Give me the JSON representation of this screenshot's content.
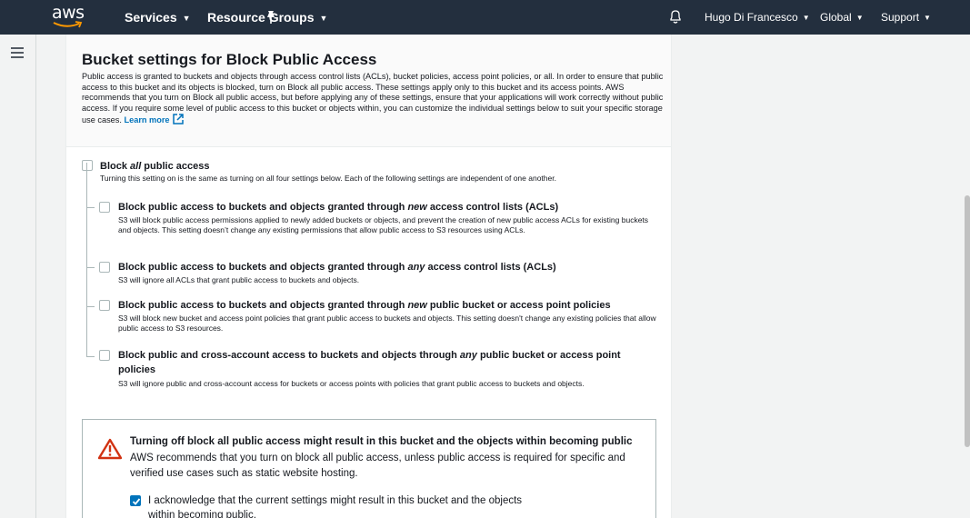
{
  "topnav": {
    "logo_text": "aws",
    "services": "Services",
    "resource_groups": "Resource Groups",
    "user": "Hugo Di Francesco",
    "region": "Global",
    "support": "Support",
    "caret": "▼"
  },
  "panel": {
    "title": "Bucket settings for Block Public Access",
    "description": "Public access is granted to buckets and objects through access control lists (ACLs), bucket policies, access point policies, or all. In order to ensure that public access to this bucket and its objects is blocked, turn on Block all public access. These settings apply only to this bucket and its access points. AWS recommends that you turn on Block all public access, but before applying any of these settings, ensure that your applications will work correctly without public access. If you require some level of public access to this bucket or objects within, you can customize the individual settings below to suit your specific storage use cases.",
    "learn_more": "Learn more"
  },
  "block_all": {
    "title_pre": "Block ",
    "title_em": "all",
    "title_post": " public access",
    "desc": "Turning this setting on is the same as turning on all four settings below. Each of the following settings are independent of one another.",
    "checked": false
  },
  "options": [
    {
      "title_pre": "Block public access to buckets and objects granted through ",
      "title_em": "new",
      "title_post": " access control lists (ACLs)",
      "desc": "S3 will block public access permissions applied to newly added buckets or objects, and prevent the creation of new public access ACLs for existing buckets and objects. This setting doesn’t change any existing permissions that allow public access to S3 resources using ACLs.",
      "checked": false
    },
    {
      "title_pre": "Block public access to buckets and objects granted through ",
      "title_em": "any",
      "title_post": " access control lists (ACLs)",
      "desc": "S3 will ignore all ACLs that grant public access to buckets and objects.",
      "checked": false
    },
    {
      "title_pre": "Block public access to buckets and objects granted through ",
      "title_em": "new",
      "title_post": " public bucket or access point policies",
      "desc": "S3 will block new bucket and access point policies that grant public access to buckets and objects. This setting doesn't change any existing policies that allow public access to S3 resources.",
      "checked": false
    },
    {
      "title_pre": "Block public and cross-account access to buckets and objects through ",
      "title_em": "any",
      "title_post": " public bucket or access point",
      "title_line2": "policies",
      "desc": "S3 will ignore public and cross-account access for buckets or access points with policies that grant public access to buckets and objects.",
      "checked": false
    }
  ],
  "warning": {
    "title": "Turning off block all public access might result in this bucket and the objects within becoming public",
    "desc": "AWS recommends that you turn on block all public access, unless public access is required for specific and verified use cases such as static website hosting.",
    "ack_label": "I acknowledge that the current settings might result in this bucket and the objects within becoming public.",
    "ack_checked": true
  },
  "colors": {
    "nav_bg": "#232f3e",
    "accent": "#0073bb",
    "warning_red": "#d13212",
    "logo_orange": "#ff9900"
  }
}
